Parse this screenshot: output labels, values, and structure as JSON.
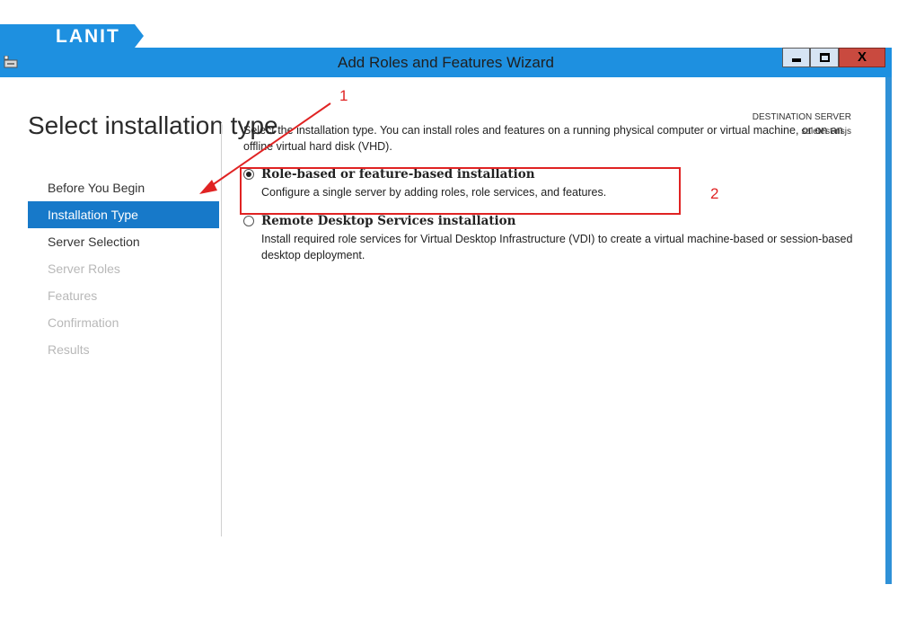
{
  "brand": {
    "text": "LANIT",
    "color": "#1e90e0"
  },
  "window": {
    "title": "Add Roles and Features Wizard",
    "minimize_label": "",
    "close_label": "X",
    "app_icon": "wizard-app-icon"
  },
  "page_title": "Select installation type",
  "destination": {
    "label": "DESTINATION SERVER",
    "server": "saletest-nsjs"
  },
  "sidebar": {
    "items": [
      {
        "label": "Before You Begin",
        "state": "normal"
      },
      {
        "label": "Installation Type",
        "state": "active"
      },
      {
        "label": "Server Selection",
        "state": "normal"
      },
      {
        "label": "Server Roles",
        "state": "disabled"
      },
      {
        "label": "Features",
        "state": "disabled"
      },
      {
        "label": "Confirmation",
        "state": "disabled"
      },
      {
        "label": "Results",
        "state": "disabled"
      }
    ]
  },
  "content": {
    "description": "Select the installation type. You can install roles and features on a running physical computer or virtual machine, or on an offline virtual hard disk (VHD).",
    "options": [
      {
        "title": "Role-based or feature-based installation",
        "description": "Configure a single server by adding roles, role services, and features.",
        "selected": true
      },
      {
        "title": "Remote Desktop Services installation",
        "description": "Install required role services for Virtual Desktop Infrastructure (VDI) to create a virtual machine-based or session-based desktop deployment.",
        "selected": false
      }
    ]
  },
  "annotations": {
    "arrow_label": "1",
    "box_label": "2",
    "color": "#e02323"
  }
}
